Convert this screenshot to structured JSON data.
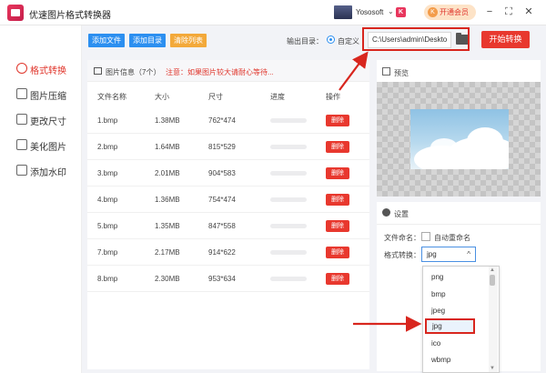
{
  "app": {
    "title": "优速图片格式转换器",
    "user_name": "Yososoft",
    "user_caret": "⌄",
    "user_badge": "K",
    "vip_icon": "K",
    "vip_label": "开通会员",
    "window_min": "−",
    "window_max": "⛶",
    "window_close": "✕",
    "accent_color": "#e8382e",
    "blue_color": "#2c8ff0"
  },
  "sidebar": {
    "items": [
      {
        "label": "格式转换",
        "icon": "convert-icon",
        "active": true
      },
      {
        "label": "图片压缩",
        "icon": "compress-icon",
        "active": false
      },
      {
        "label": "更改尺寸",
        "icon": "resize-icon",
        "active": false
      },
      {
        "label": "美化图片",
        "icon": "beautify-icon",
        "active": false
      },
      {
        "label": "添加水印",
        "icon": "watermark-icon",
        "active": false
      }
    ]
  },
  "toolbar": {
    "add_file": "添加文件",
    "add_dir": "添加目录",
    "clear_list": "清除列表",
    "output_label": "输出目录：",
    "custom_label": "自定义",
    "output_path": "C:\\Users\\admin\\Deskto",
    "start": "开始转换"
  },
  "file_list": {
    "info_title": "图片信息（7个）",
    "info_note": "注意：如果图片较大请耐心等待...",
    "headers": {
      "name": "文件名称",
      "size": "大小",
      "dims": "尺寸",
      "progress": "进度",
      "action": "操作"
    },
    "delete_label": "删除",
    "rows": [
      {
        "name": "1.bmp",
        "size": "1.38MB",
        "dims": "762*474",
        "progress": 0
      },
      {
        "name": "2.bmp",
        "size": "1.64MB",
        "dims": "815*529",
        "progress": 0
      },
      {
        "name": "3.bmp",
        "size": "2.01MB",
        "dims": "904*583",
        "progress": 0
      },
      {
        "name": "4.bmp",
        "size": "1.36MB",
        "dims": "754*474",
        "progress": 0
      },
      {
        "name": "5.bmp",
        "size": "1.35MB",
        "dims": "847*558",
        "progress": 0
      },
      {
        "name": "7.bmp",
        "size": "2.17MB",
        "dims": "914*622",
        "progress": 0
      },
      {
        "name": "8.bmp",
        "size": "2.30MB",
        "dims": "953*634",
        "progress": 0
      }
    ]
  },
  "preview": {
    "title": "预览"
  },
  "settings": {
    "title": "设置",
    "rename_label": "文件命名：",
    "rename_option": "自动重命名",
    "format_label": "格式转换：",
    "format_value": "jpg",
    "format_caret": "^",
    "options": [
      "png",
      "bmp",
      "jpeg",
      "jpg",
      "ico",
      "wbmp"
    ],
    "highlighted": "jpg",
    "scroll_up": "▲",
    "scroll_down": "▼"
  }
}
